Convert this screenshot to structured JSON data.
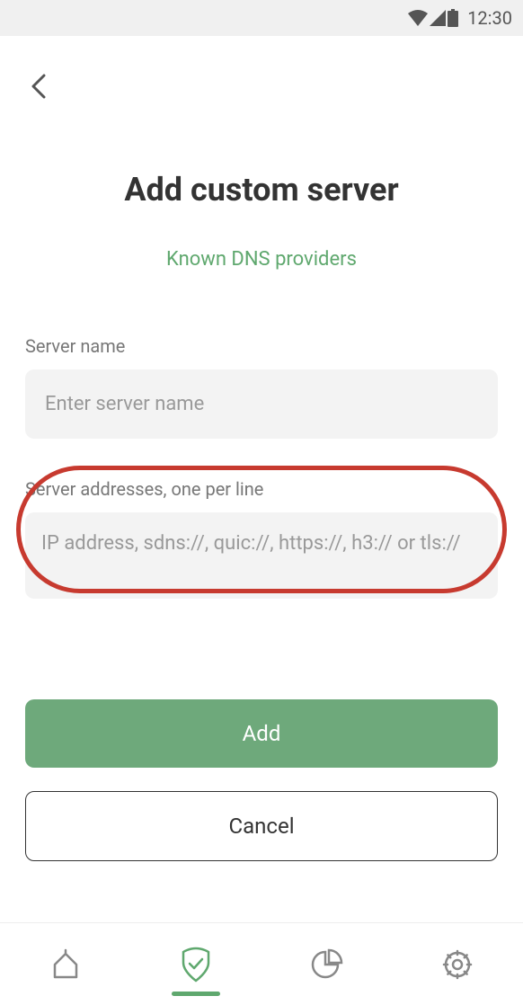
{
  "status_bar": {
    "time": "12:30"
  },
  "page": {
    "title": "Add custom server",
    "known_providers_link": "Known DNS providers"
  },
  "form": {
    "server_name_label": "Server name",
    "server_name_placeholder": "Enter server name",
    "server_addresses_label": "Server addresses, one per line",
    "server_addresses_placeholder": "IP address, sdns://, quic://, https://, h3:// or tls://"
  },
  "buttons": {
    "add": "Add",
    "cancel": "Cancel"
  }
}
